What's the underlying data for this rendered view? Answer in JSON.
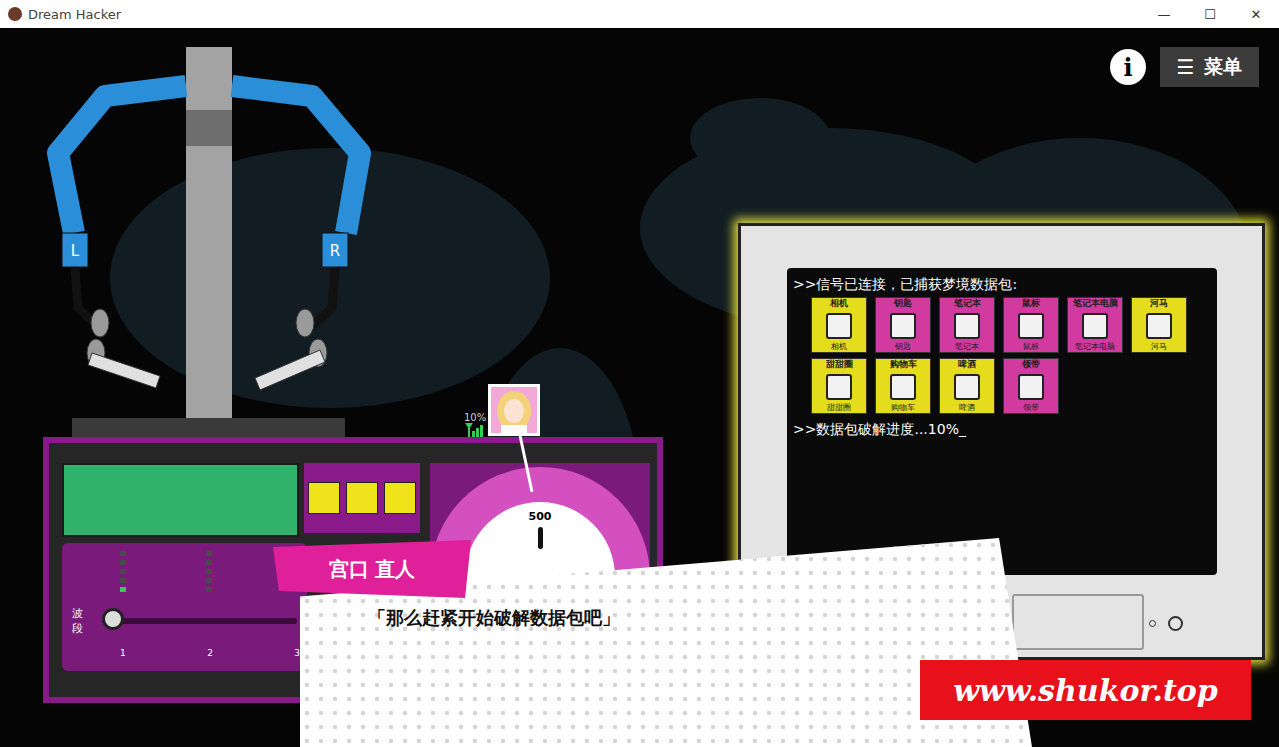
{
  "window": {
    "title": "Dream Hacker",
    "controls": [
      "—",
      "☐",
      "✕"
    ]
  },
  "toolbar": {
    "info": "i",
    "menu_icon": "☰",
    "menu": "菜单"
  },
  "headset": {
    "left": "L",
    "right": "R"
  },
  "terminal": {
    "header": ">>信号已连接，已捕获梦境数据包:",
    "packets": [
      {
        "name": "相机",
        "color": "#e6dc1e"
      },
      {
        "name": "钥匙",
        "color": "#d23aa0"
      },
      {
        "name": "笔记本",
        "color": "#d23aa0"
      },
      {
        "name": "鼠标",
        "color": "#d23aa0"
      },
      {
        "name": "笔记本电脑",
        "color": "#d23aa0"
      },
      {
        "name": "河马",
        "color": "#e6dc1e"
      },
      {
        "name": "甜甜圈",
        "color": "#e6dc1e"
      },
      {
        "name": "购物车",
        "color": "#e6dc1e"
      },
      {
        "name": "啤酒",
        "color": "#e6dc1e"
      },
      {
        "name": "领带",
        "color": "#d23aa0"
      }
    ],
    "progress": ">>数据包破解进度...10%_"
  },
  "signal": {
    "reading": "10%"
  },
  "device": {
    "lamps": [
      {
        "on": true
      },
      {
        "on": true
      },
      {
        "on": true
      }
    ],
    "dial": "500",
    "meters": [
      {
        "level": 0.2
      },
      {
        "level": 0
      }
    ],
    "band": {
      "label": "波段",
      "level": 0,
      "ticks": [
        "1",
        "2",
        "3"
      ]
    }
  },
  "dialog": {
    "speaker": "宫口 直人",
    "text": "「那么赶紧开始破解数据包吧」"
  },
  "watermark": "www.shukor.top"
}
